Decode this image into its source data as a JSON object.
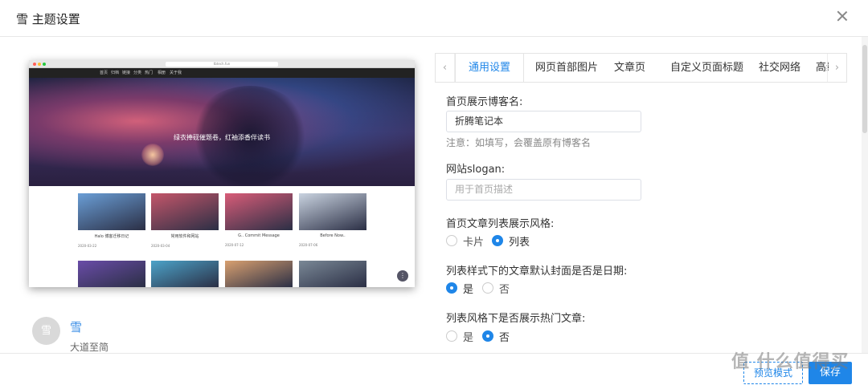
{
  "dialog": {
    "title": "雪 主题设置"
  },
  "preview": {
    "url": "tbtech.fun",
    "nav": [
      "首页",
      "归档",
      "链接",
      "分类",
      "热门",
      "相册",
      "关于我"
    ],
    "slogan": "绿衣捧砚催题卷，红袖添香伴读书",
    "cards": [
      {
        "title": "Halo 博客迁移日记",
        "date": "2020-03-22"
      },
      {
        "title": "常用软件和网站",
        "date": "2020-03-04"
      },
      {
        "title": "G.. Commit Message",
        "date": "2020-07-12"
      },
      {
        "title": "Before Now..",
        "date": "2020-07-06"
      }
    ],
    "card_colors": [
      "#6a9ed6",
      "#c4566a",
      "#d85c78",
      "#c9d3e0"
    ],
    "card2_colors": [
      "#6a4ca8",
      "#4ca3c9",
      "#d9a070",
      "#7a8896"
    ]
  },
  "author": {
    "avatar_text": "雪",
    "name": "雪",
    "bio": "大道至简"
  },
  "tabs": {
    "left_arrow": "‹",
    "right_arrow": "›",
    "items": [
      "通用设置",
      "网页首部图片",
      "文章页",
      "自定义页面标题",
      "社交网络",
      "高级"
    ]
  },
  "form": {
    "blog_name": {
      "label": "首页展示博客名:",
      "value": "折腾笔记本",
      "hint": "注意：如填写，会覆盖原有博客名"
    },
    "slogan": {
      "label": "网站slogan:",
      "placeholder": "用于首页描述"
    },
    "list_style": {
      "label": "首页文章列表展示风格:",
      "options": [
        "卡片",
        "列表"
      ],
      "selected": "列表"
    },
    "cover_date": {
      "label": "列表样式下的文章默认封面是否是日期:",
      "options": [
        "是",
        "否"
      ],
      "selected": "是"
    },
    "hot_posts": {
      "label": "列表风格下是否展示热门文章:",
      "options": [
        "是",
        "否"
      ],
      "selected": "否"
    }
  },
  "footer": {
    "preview_label": "预览模式",
    "save_label": "保存"
  },
  "watermark": "值 什么值得买",
  "colors": {
    "accent": "#1f86e8"
  }
}
